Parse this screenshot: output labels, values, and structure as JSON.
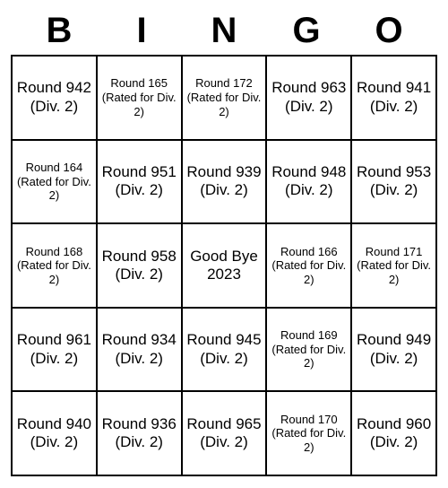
{
  "header": [
    "B",
    "I",
    "N",
    "G",
    "O"
  ],
  "cells": [
    {
      "text": "Round 942 (Div. 2)",
      "small": false
    },
    {
      "text": "Round 165 (Rated for Div. 2)",
      "small": true
    },
    {
      "text": "Round 172 (Rated for Div. 2)",
      "small": true
    },
    {
      "text": "Round 963 (Div. 2)",
      "small": false
    },
    {
      "text": "Round 941 (Div. 2)",
      "small": false
    },
    {
      "text": "Round 164 (Rated for Div. 2)",
      "small": true
    },
    {
      "text": "Round 951 (Div. 2)",
      "small": false
    },
    {
      "text": "Round 939 (Div. 2)",
      "small": false
    },
    {
      "text": "Round 948 (Div. 2)",
      "small": false
    },
    {
      "text": "Round 953 (Div. 2)",
      "small": false
    },
    {
      "text": "Round 168 (Rated for Div. 2)",
      "small": true
    },
    {
      "text": "Round 958 (Div. 2)",
      "small": false
    },
    {
      "text": "Good Bye 2023",
      "small": false
    },
    {
      "text": "Round 166 (Rated for Div. 2)",
      "small": true
    },
    {
      "text": "Round 171 (Rated for Div. 2)",
      "small": true
    },
    {
      "text": "Round 961 (Div. 2)",
      "small": false
    },
    {
      "text": "Round 934 (Div. 2)",
      "small": false
    },
    {
      "text": "Round 945 (Div. 2)",
      "small": false
    },
    {
      "text": "Round 169 (Rated for Div. 2)",
      "small": true
    },
    {
      "text": "Round 949 (Div. 2)",
      "small": false
    },
    {
      "text": "Round 940 (Div. 2)",
      "small": false
    },
    {
      "text": "Round 936 (Div. 2)",
      "small": false
    },
    {
      "text": "Round 965 (Div. 2)",
      "small": false
    },
    {
      "text": "Round 170 (Rated for Div. 2)",
      "small": true
    },
    {
      "text": "Round 960 (Div. 2)",
      "small": false
    }
  ]
}
